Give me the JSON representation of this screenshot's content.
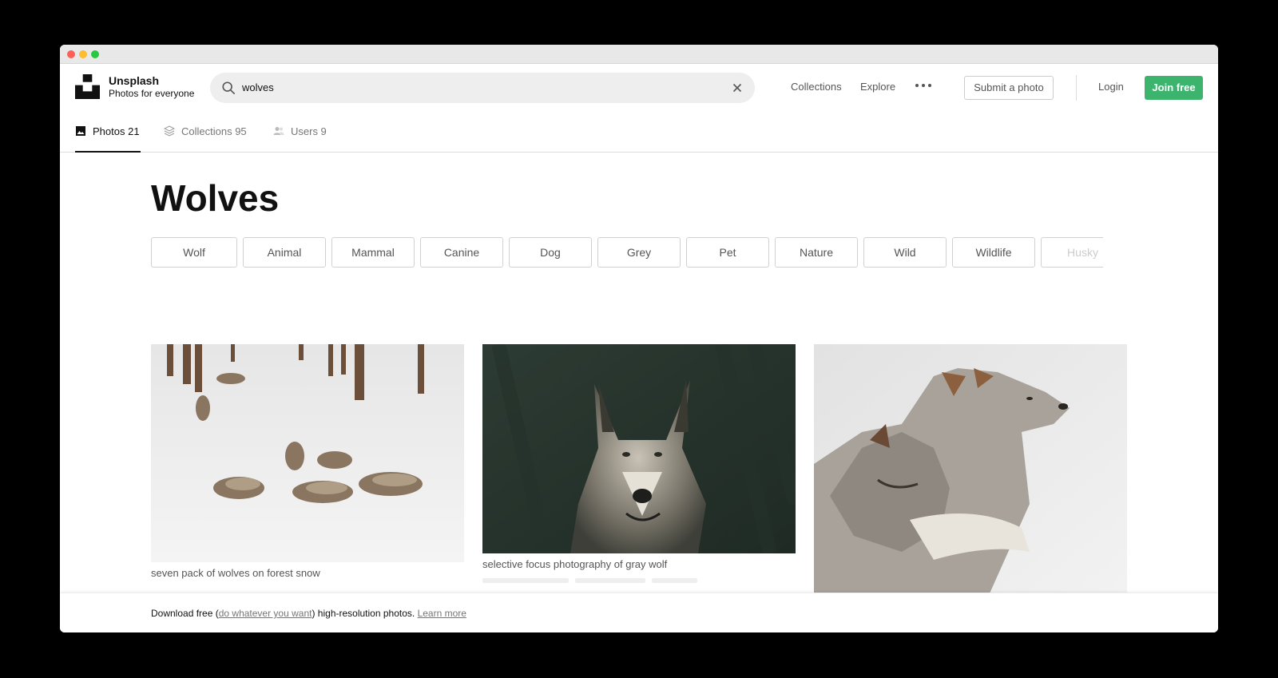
{
  "header": {
    "brand_name": "Unsplash",
    "brand_tagline": "Photos for everyone",
    "search_value": "wolves",
    "nav": {
      "collections": "Collections",
      "explore": "Explore"
    },
    "submit_label": "Submit a photo",
    "login_label": "Login",
    "join_label": "Join free",
    "accent_color": "#3cb46e"
  },
  "tabs": [
    {
      "label": "Photos 21",
      "icon": "image-icon",
      "active": true
    },
    {
      "label": "Collections 95",
      "icon": "stack-icon",
      "active": false
    },
    {
      "label": "Users 9",
      "icon": "users-icon",
      "active": false
    }
  ],
  "main": {
    "title": "Wolves",
    "related_tags": [
      "Wolf",
      "Animal",
      "Mammal",
      "Canine",
      "Dog",
      "Grey",
      "Pet",
      "Nature",
      "Wild",
      "Wildlife",
      "Husky"
    ]
  },
  "photos": [
    {
      "caption": "seven pack of wolves on forest snow"
    },
    {
      "caption": "selective focus photography of gray wolf"
    },
    {
      "caption": ""
    }
  ],
  "banner": {
    "prefix": "Download free (",
    "link1": "do whatever you want",
    "middle": ") high-resolution photos.",
    "link2": "Learn more"
  }
}
